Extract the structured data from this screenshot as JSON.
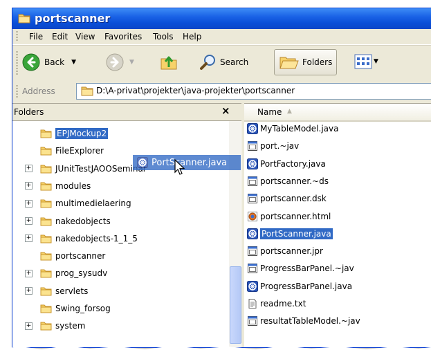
{
  "window": {
    "title": "portscanner"
  },
  "menu": [
    "File",
    "Edit",
    "View",
    "Favorites",
    "Tools",
    "Help"
  ],
  "toolbar": {
    "back_label": "Back",
    "search_label": "Search",
    "folders_label": "Folders"
  },
  "address": {
    "label": "Address",
    "path": "D:\\A-privat\\projekter\\java-projekter\\portscanner"
  },
  "folders_pane": {
    "title": "Folders",
    "close": "×",
    "items": [
      {
        "label": "EPJMockup2",
        "expandable": false,
        "selected": true
      },
      {
        "label": "FileExplorer",
        "expandable": false,
        "selected": false
      },
      {
        "label": "JUnitTestJAOOSeminar",
        "expandable": true,
        "selected": false
      },
      {
        "label": "modules",
        "expandable": true,
        "selected": false
      },
      {
        "label": "multimedielaering",
        "expandable": true,
        "selected": false
      },
      {
        "label": "nakedobjects",
        "expandable": true,
        "selected": false
      },
      {
        "label": "nakedobjects-1_1_5",
        "expandable": true,
        "selected": false
      },
      {
        "label": "portscanner",
        "expandable": false,
        "selected": false
      },
      {
        "label": "prog_sysudv",
        "expandable": true,
        "selected": false
      },
      {
        "label": "servlets",
        "expandable": true,
        "selected": false
      },
      {
        "label": "Swing_forsog",
        "expandable": false,
        "selected": false
      },
      {
        "label": "system",
        "expandable": true,
        "selected": false
      }
    ]
  },
  "drag": {
    "label": "PortScanner.java",
    "icon": "java-file-icon"
  },
  "files_pane": {
    "column": "Name",
    "sort_glyph": "▲",
    "files": [
      {
        "name": "MyTableModel.java",
        "icon": "java-file-icon",
        "selected": false
      },
      {
        "name": "port.~jav",
        "icon": "generic-file-icon",
        "selected": false
      },
      {
        "name": "PortFactory.java",
        "icon": "java-file-icon",
        "selected": false
      },
      {
        "name": "portscanner.~ds",
        "icon": "generic-file-icon",
        "selected": false
      },
      {
        "name": "portscanner.dsk",
        "icon": "generic-file-icon",
        "selected": false
      },
      {
        "name": "portscanner.html",
        "icon": "html-file-icon",
        "selected": false
      },
      {
        "name": "PortScanner.java",
        "icon": "java-file-icon",
        "selected": true
      },
      {
        "name": "portscanner.jpr",
        "icon": "generic-file-icon",
        "selected": false
      },
      {
        "name": "ProgressBarPanel.~jav",
        "icon": "generic-file-icon",
        "selected": false
      },
      {
        "name": "ProgressBarPanel.java",
        "icon": "java-file-icon",
        "selected": false
      },
      {
        "name": "readme.txt",
        "icon": "text-file-icon",
        "selected": false
      },
      {
        "name": "resultatTableModel.~jav",
        "icon": "generic-file-icon",
        "selected": false
      }
    ]
  },
  "colors": {
    "titlebar": "#0a4fd8",
    "selection": "#316ac5",
    "folder": "#f2c54d"
  }
}
